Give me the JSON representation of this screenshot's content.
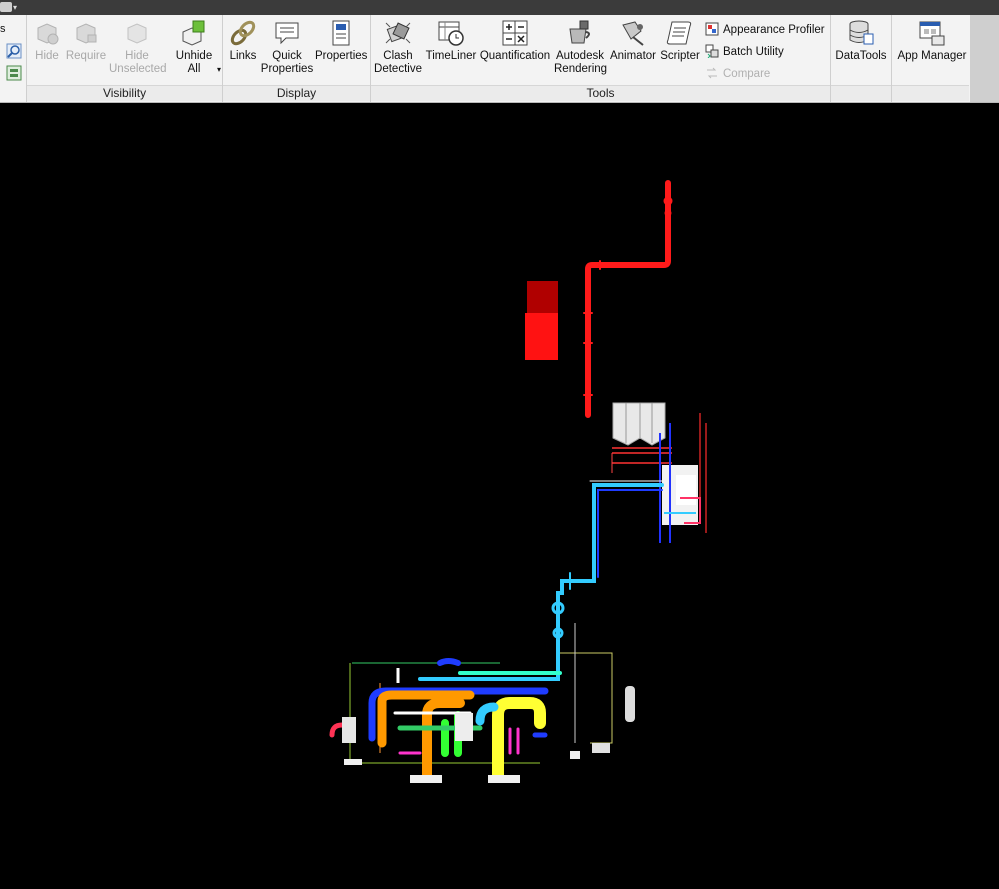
{
  "left_strip": {
    "fragment_text": "s"
  },
  "panels": {
    "visibility": {
      "label": "Visibility",
      "buttons": {
        "hide": "Hide",
        "require": "Require",
        "hide_unselected_1": "Hide",
        "hide_unselected_2": "Unselected",
        "unhide_all_1": "Unhide",
        "unhide_all_2": "All"
      }
    },
    "display": {
      "label": "Display",
      "buttons": {
        "links": "Links",
        "quick_properties_1": "Quick",
        "quick_properties_2": "Properties",
        "properties": "Properties"
      }
    },
    "tools": {
      "label": "Tools",
      "buttons": {
        "clash_detective_1": "Clash",
        "clash_detective_2": "Detective",
        "timeliner": "TimeLiner",
        "quantification": "Quantification",
        "autodesk_rendering_1": "Autodesk",
        "autodesk_rendering_2": "Rendering",
        "animator": "Animator",
        "scripter": "Scripter",
        "appearance_profiler": "Appearance Profiler",
        "batch_utility": "Batch Utility",
        "compare": "Compare"
      }
    },
    "datatools": {
      "label": "DataTools"
    },
    "app_manager": {
      "label": "App Manager"
    }
  },
  "colors": {
    "ribbon_bg": "#f3f3f3",
    "viewport_bg": "#000000",
    "pipe_red": "#ff1a1a",
    "pipe_cyan": "#33ccff",
    "pipe_yellow": "#ffff33",
    "pipe_orange": "#ff9900",
    "pipe_green": "#33ff33",
    "pipe_blue": "#1f3cff",
    "pipe_magenta": "#ff33cc"
  }
}
